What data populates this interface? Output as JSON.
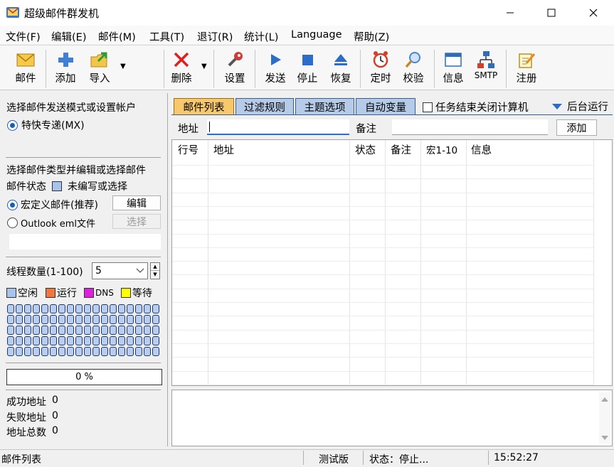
{
  "window": {
    "title": "超级邮件群发机",
    "minimize_icon": "minimize-icon",
    "maximize_icon": "maximize-icon",
    "close_icon": "close-icon"
  },
  "menu": [
    "文件(F)",
    "编辑(E)",
    "邮件(M)",
    "工具(T)",
    "退订(R)",
    "统计(L)",
    "Language",
    "帮助(Z)"
  ],
  "toolbar": {
    "mail": "邮件",
    "add": "添加",
    "import": "导入",
    "delete": "删除",
    "settings": "设置",
    "send": "发送",
    "stop": "停止",
    "resume": "恢复",
    "schedule": "定时",
    "verify": "校验",
    "info": "信息",
    "smtp": "SMTP",
    "register": "注册"
  },
  "left": {
    "mode_title": "选择邮件发送模式或设置帐户",
    "mode_option": "特快专递(MX)",
    "mail_type_title": "选择邮件类型并编辑或选择邮件",
    "mail_status_label": "邮件状态",
    "mail_status_value": "未编写或选择",
    "macro_mail": "宏定义邮件(推荐)",
    "edit_button": "编辑",
    "outlook_eml": "Outlook eml文件",
    "select_button": "选择",
    "file_path": "",
    "thread_label": "线程数量(1-100)",
    "thread_value": "5",
    "legend": [
      {
        "label": "空闲",
        "color": "#a9c4ec"
      },
      {
        "label": "运行",
        "color": "#f07840"
      },
      {
        "label": "DNS",
        "color": "#e020e0"
      },
      {
        "label": "等待",
        "color": "#ffff00"
      }
    ],
    "progress_text": "0 %",
    "progress_value": 0,
    "success_label": "成功地址",
    "success_value": "0",
    "failed_label": "失败地址",
    "failed_value": "0",
    "total_label": "地址总数",
    "total_value": "0"
  },
  "right": {
    "tabs": [
      "邮件列表",
      "过滤规则",
      "主题选项",
      "自动变量"
    ],
    "shutdown_label": "任务结束关闭计算机",
    "background_label": "后台运行",
    "address_label": "地址",
    "address_value": "",
    "note_label": "备注",
    "note_value": "",
    "add_button": "添加",
    "columns": [
      "行号",
      "地址",
      "状态",
      "备注",
      "宏1-10",
      "信息"
    ]
  },
  "status": {
    "left": "邮件列表",
    "edition": "测试版",
    "state": "状态：停止...",
    "time": "15:52:27"
  },
  "colors": {
    "active_tab": "#f8c96c",
    "inactive_tab": "#b6cbe8",
    "accent": "#1a5fb4"
  }
}
